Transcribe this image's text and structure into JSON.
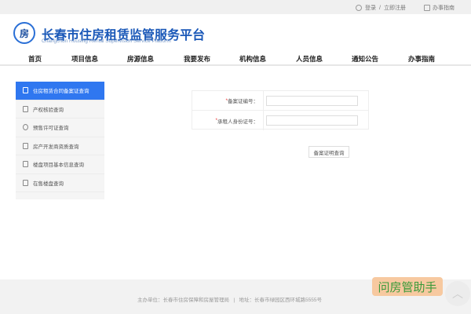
{
  "topbar": {
    "login": "登录",
    "sep": "/",
    "register": "立即注册",
    "guide": "办事指南"
  },
  "header": {
    "logo_text": "房",
    "title": "长春市住房租赁监管服务平台",
    "subtitle": "Changchun Housing Rental Supervision Service Platform"
  },
  "nav": [
    "首页",
    "项目信息",
    "房源信息",
    "我要发布",
    "机构信息",
    "人员信息",
    "通知公告",
    "办事指南"
  ],
  "sidebar": [
    {
      "label": "住房租赁合同备案证查询",
      "active": true
    },
    {
      "label": "产权核验查询"
    },
    {
      "label": "预售许可证查询"
    },
    {
      "label": "房产开发商资质查询"
    },
    {
      "label": "楼盘项目基本信息查询"
    },
    {
      "label": "在售楼盘查询"
    }
  ],
  "form": {
    "required_mark": "*",
    "fields": [
      {
        "label": "备案证编号：",
        "value": ""
      },
      {
        "label": "承租人身份证号：",
        "value": ""
      }
    ],
    "submit": "备案证明查询"
  },
  "footer": {
    "text": "主办单位：长春市住房保障和房屋管理局   |   地址：长春市绿园区西环城路5555号"
  },
  "badge": "问房管助手",
  "totop": "︿"
}
